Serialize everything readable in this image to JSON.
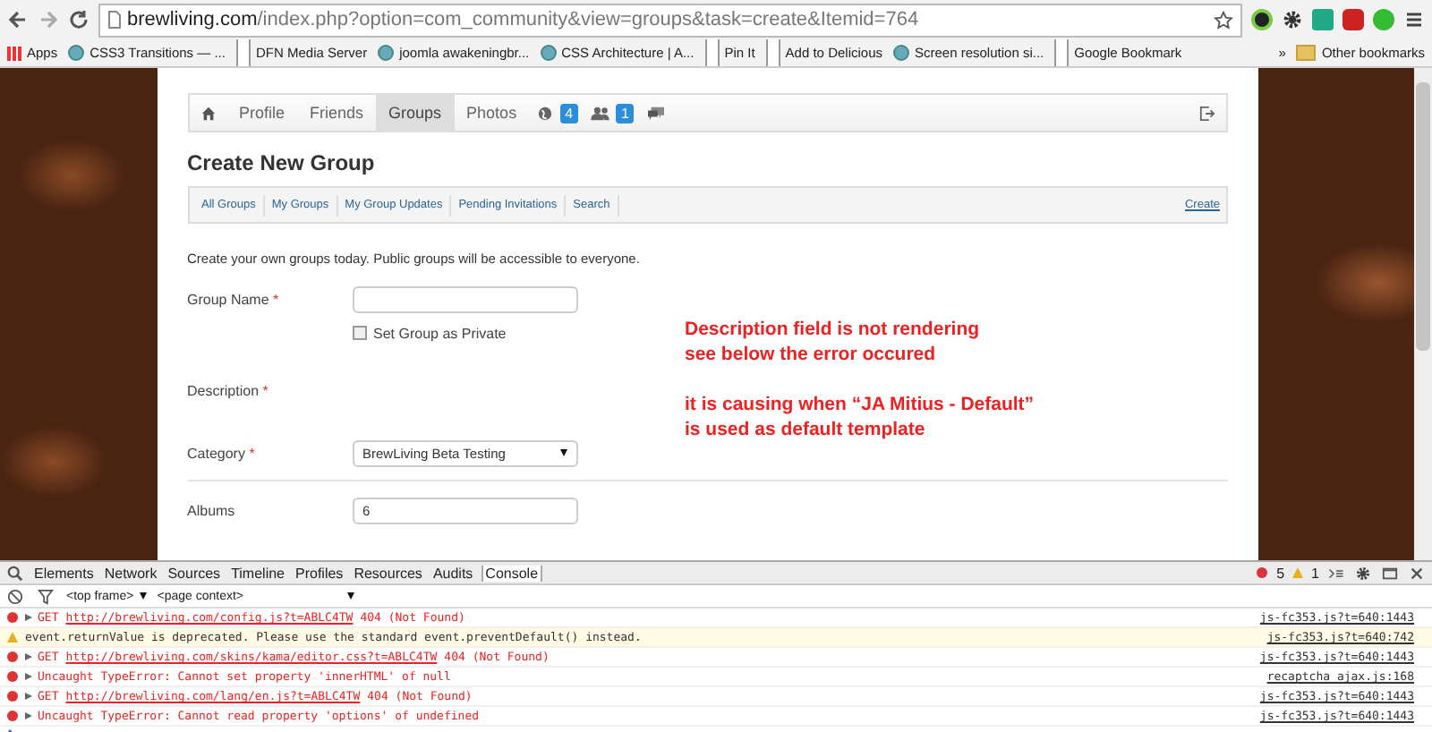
{
  "browser": {
    "url_host": "brewliving.com",
    "url_path": "/index.php?option=com_community&view=groups&task=create&Itemid=764",
    "bookmarks": [
      {
        "label": "Apps",
        "kind": "apps"
      },
      {
        "label": "CSS3 Transitions — ...",
        "kind": "site"
      },
      {
        "label": "DFN Media Server",
        "kind": "page"
      },
      {
        "label": "joomla awakeningbr...",
        "kind": "site"
      },
      {
        "label": "CSS Architecture | A...",
        "kind": "site"
      },
      {
        "label": "Pin It",
        "kind": "page"
      },
      {
        "label": "Add to Delicious",
        "kind": "page"
      },
      {
        "label": "Screen resolution si...",
        "kind": "site"
      },
      {
        "label": "Google Bookmark",
        "kind": "page"
      }
    ],
    "overflow": "»",
    "other_bookmarks": "Other bookmarks"
  },
  "toolbar": {
    "tabs": [
      {
        "label": "Profile",
        "selected": false
      },
      {
        "label": "Friends",
        "selected": false
      },
      {
        "label": "Groups",
        "selected": true
      },
      {
        "label": "Photos",
        "selected": false
      }
    ],
    "badges": [
      {
        "count": "4",
        "kind": "globe"
      },
      {
        "count": "1",
        "kind": "people"
      },
      {
        "kind": "chat"
      }
    ]
  },
  "title": "Create New Group",
  "subnav": {
    "links": [
      "All Groups",
      "My Groups",
      "My Group Updates",
      "Pending Invitations",
      "Search"
    ],
    "create": "Create"
  },
  "intro": "Create your own groups today. Public groups will be accessible to everyone.",
  "form": {
    "group_name": {
      "label": "Group Name",
      "required": "*"
    },
    "private": {
      "label": "Set Group as Private",
      "checked": false
    },
    "description": {
      "label": "Description",
      "required": "*"
    },
    "category": {
      "label": "Category",
      "required": "*",
      "value": "BrewLiving Beta Testing"
    },
    "albums": {
      "label": "Albums",
      "value": "6"
    }
  },
  "annotation": [
    {
      "lines": [
        "Description field is not rendering",
        "see below the error occured"
      ]
    },
    {
      "lines": [
        "it is causing when “JA Mitius - Default”",
        "is used as default template"
      ]
    }
  ],
  "devtools": {
    "tabs": [
      {
        "label": "Elements",
        "selected": false
      },
      {
        "label": "Network",
        "selected": false
      },
      {
        "label": "Sources",
        "selected": false
      },
      {
        "label": "Timeline",
        "selected": false
      },
      {
        "label": "Profiles",
        "selected": false
      },
      {
        "label": "Resources",
        "selected": false
      },
      {
        "label": "Audits",
        "selected": false
      },
      {
        "label": "Console",
        "selected": true
      }
    ],
    "error_count": "5",
    "warning_count": "1",
    "frame": "<top frame>",
    "context": "<page context>",
    "messages": [
      {
        "kind": "error",
        "prefix": "GET",
        "url": "http://brewliving.com/config.js?t=ABLC4TW",
        "text": "404 (Not Found)",
        "source": "js-fc353.js?t=640:1443"
      },
      {
        "kind": "warning",
        "text": "event.returnValue is deprecated. Please use the standard event.preventDefault() instead.",
        "source": "js-fc353.js?t=640:742"
      },
      {
        "kind": "error",
        "prefix": "GET",
        "url": "http://brewliving.com/skins/kama/editor.css?t=ABLC4TW",
        "text": "404 (Not Found)",
        "source": "js-fc353.js?t=640:1443"
      },
      {
        "kind": "error",
        "text": "Uncaught TypeError: Cannot set property 'innerHTML' of null",
        "source": "recaptcha_ajax.js:168"
      },
      {
        "kind": "error",
        "prefix": "GET",
        "url": "http://brewliving.com/lang/en.js?t=ABLC4TW",
        "text": "404 (Not Found)",
        "source": "js-fc353.js?t=640:1443"
      },
      {
        "kind": "error",
        "text": "Uncaught TypeError: Cannot read property 'options' of undefined",
        "source": "js-fc353.js?t=640:1443"
      }
    ]
  }
}
